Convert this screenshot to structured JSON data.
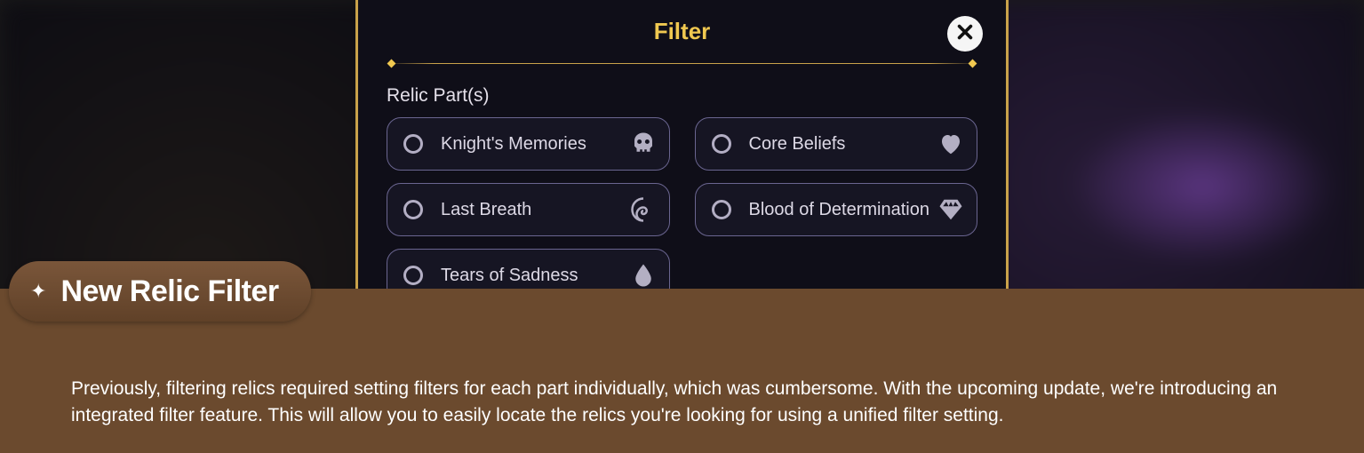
{
  "dialog": {
    "title": "Filter",
    "section_label": "Relic Part(s)",
    "options": [
      {
        "label": "Knight's Memories",
        "icon": "skull"
      },
      {
        "label": "Core Beliefs",
        "icon": "heart"
      },
      {
        "label": "Last Breath",
        "icon": "swirl"
      },
      {
        "label": "Blood of Determination",
        "icon": "gem"
      },
      {
        "label": "Tears of Sadness",
        "icon": "drop"
      }
    ]
  },
  "caption": {
    "title": "New Relic Filter",
    "body": "Previously, filtering relics required setting filters for each part individually, which was cumbersome. With the upcoming update, we're introducing an integrated filter feature. This will allow you to easily locate the relics you're looking for using a unified filter setting."
  }
}
